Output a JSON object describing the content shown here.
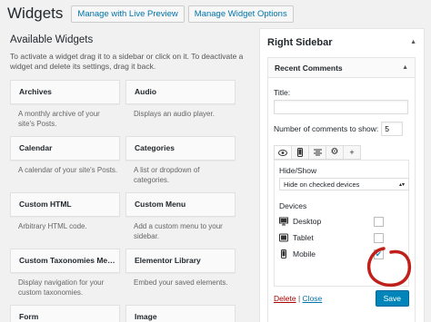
{
  "header": {
    "title": "Widgets",
    "live_preview": "Manage with Live Preview",
    "manage_options": "Manage Widget Options"
  },
  "available": {
    "title": "Available Widgets",
    "description": "To activate a widget drag it to a sidebar or click on it. To deactivate a widget and delete its settings, drag it back.",
    "widgets": [
      {
        "title": "Archives",
        "desc": "A monthly archive of your site's Posts."
      },
      {
        "title": "Audio",
        "desc": "Displays an audio player."
      },
      {
        "title": "Calendar",
        "desc": "A calendar of your site's Posts."
      },
      {
        "title": "Categories",
        "desc": "A list or dropdown of categories."
      },
      {
        "title": "Custom HTML",
        "desc": "Arbitrary HTML code."
      },
      {
        "title": "Custom Menu",
        "desc": "Add a custom menu to your sidebar."
      },
      {
        "title": "Custom Taxonomies Me…",
        "desc": "Display navigation for your custom taxonomies."
      },
      {
        "title": "Elementor Library",
        "desc": "Embed your saved elements."
      },
      {
        "title": "Form",
        "desc": ""
      },
      {
        "title": "Image",
        "desc": ""
      }
    ]
  },
  "sidebar": {
    "title": "Right Sidebar",
    "widget": {
      "title": "Recent Comments",
      "title_label": "Title:",
      "title_value": "",
      "count_label": "Number of comments to show:",
      "count_value": "5",
      "tabs": [
        "eye-icon",
        "mobile-icon",
        "align-icon",
        "gear-icon",
        "plus-icon"
      ],
      "hide_show_label": "Hide/Show",
      "hide_show_value": "Hide on checked devices",
      "devices_label": "Devices",
      "devices": [
        {
          "name": "Desktop",
          "icon": "desktop-icon",
          "checked": false
        },
        {
          "name": "Tablet",
          "icon": "tablet-icon",
          "checked": false
        },
        {
          "name": "Mobile",
          "icon": "mobile-icon",
          "checked": true
        }
      ],
      "delete_label": "Delete",
      "separator": "|",
      "close_label": "Close",
      "save_label": "Save"
    }
  },
  "colors": {
    "link": "#0073aa",
    "primary_button": "#0085ba",
    "delete": "#a00",
    "annotation": "#c0201a"
  }
}
